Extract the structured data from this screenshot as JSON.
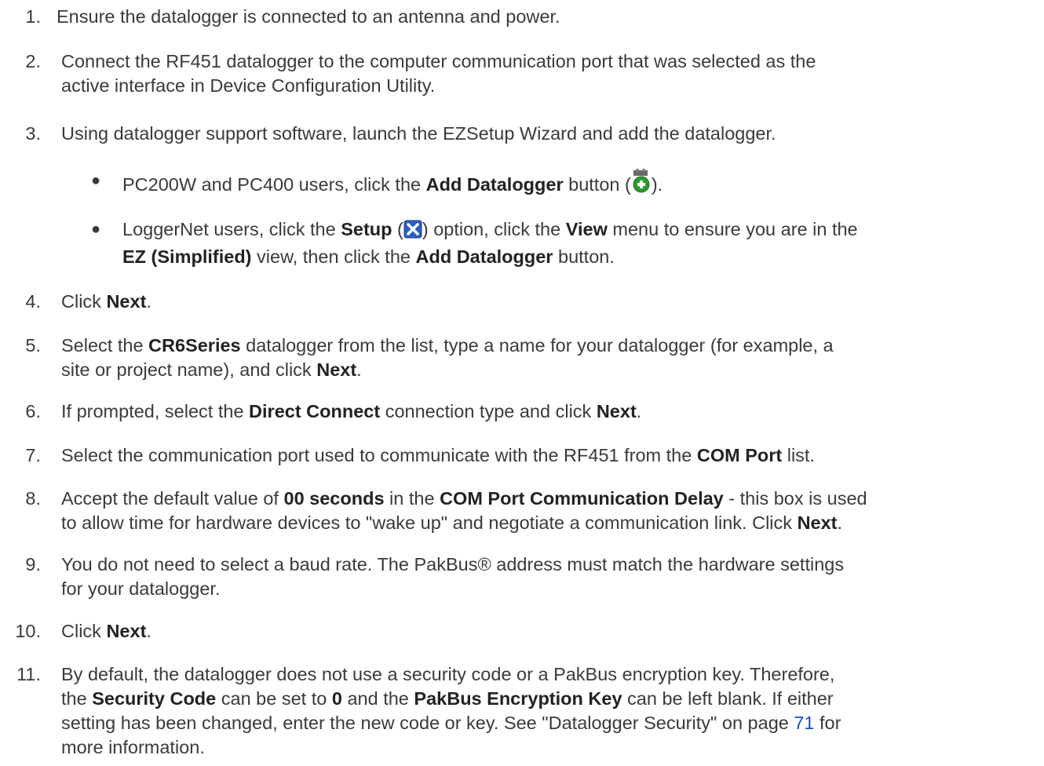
{
  "steps": [
    {
      "num": "1.",
      "text": " Ensure the datalogger is connected to an antenna and power."
    },
    {
      "num": "2.",
      "line1": "Connect the RF451 datalogger to the computer communication port that was selected as the",
      "line2": "active interface in Device Configuration Utility."
    },
    {
      "num": "3.",
      "text": "Using datalogger support software, launch the EZSetup Wizard and add the datalogger."
    },
    {
      "num": "4.",
      "a": "Click ",
      "b": "Next",
      "c": "."
    },
    {
      "num": "5.",
      "a": "Select the ",
      "b": "CR6Series",
      "c": " datalogger from the list, type a name for your datalogger (for example, a",
      "line2a": "site or project name), and click ",
      "line2b": "Next",
      "line2c": "."
    },
    {
      "num": "6.",
      "a": "If prompted, select the ",
      "b": "Direct Connect",
      "c": " connection type and click ",
      "d": "Next",
      "e": "."
    },
    {
      "num": "7.",
      "a": "Select the communication port used to communicate with the RF451 from the ",
      "b": "COM Port",
      "c": " list."
    },
    {
      "num": "8.",
      "a": "Accept the default value of ",
      "b": "00 seconds",
      "c": " in the ",
      "d": "COM Port Communication Delay",
      "e": " - this box is used",
      "line2a": "to allow time for hardware devices to \"wake up\" and negotiate a communication link. Click ",
      "line2b": "Next",
      "line2c": "."
    },
    {
      "num": "9.",
      "line1": "You do not need to select a baud rate. The PakBus® address must match the hardware settings",
      "line2": "for your datalogger."
    },
    {
      "num": "10.",
      "a": "Click ",
      "b": "Next",
      "c": "."
    },
    {
      "num": "11.",
      "line1": "By default, the datalogger does not use a security code or a PakBus encryption key. Therefore,",
      "l2a": "the ",
      "l2b": "Security Code",
      "l2c": " can be set to ",
      "l2d": "0",
      "l2e": " and the ",
      "l2f": "PakBus Encryption Key",
      "l2g": " can be left blank. If either",
      "l3a": "setting has been changed, enter the new code or key. See \"Datalogger Security\" on page ",
      "l3link": "71",
      "l3b": " for",
      "line4": "more information."
    }
  ],
  "bullets": [
    {
      "a": "PC200W and PC400 users, click the ",
      "b": "Add Datalogger",
      "c": " button (",
      "icon": "add-datalogger-icon",
      "d": ")."
    },
    {
      "a": "LoggerNet users, click the ",
      "b": "Setup",
      "c": " (",
      "icon": "setup-icon",
      "d": ") option, click the ",
      "e": "View",
      "f": " menu to ensure you are in the",
      "l2a": "EZ (Simplified)",
      "l2b": " view, then click the ",
      "l2c": "Add Datalogger",
      "l2d": " button."
    }
  ],
  "colors": {
    "text": "#3a3a3a",
    "link": "#1a4fbf"
  }
}
